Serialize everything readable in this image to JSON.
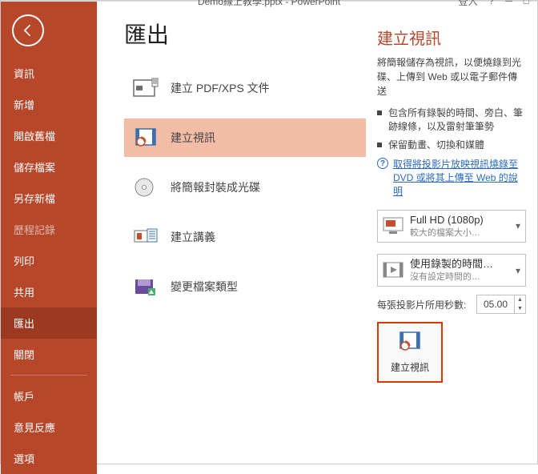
{
  "titlebar": {
    "filename": "Demo線上教學.pptx - PowerPoint",
    "signin": "登入",
    "help": "?",
    "minimize": "─",
    "restore": "□"
  },
  "sidebar": {
    "items": [
      "資訊",
      "新增",
      "開啟舊檔",
      "儲存檔案",
      "另存新檔",
      "歷程記錄",
      "列印",
      "共用",
      "匯出",
      "關閉"
    ],
    "bottom": [
      "帳戶",
      "意見反應",
      "選項"
    ]
  },
  "export": {
    "title": "匯出",
    "items": [
      {
        "label": "建立 PDF/XPS 文件"
      },
      {
        "label": "建立視訊"
      },
      {
        "label": "將簡報封裝成光碟"
      },
      {
        "label": "建立講義"
      },
      {
        "label": "變更檔案類型"
      }
    ]
  },
  "detail": {
    "title": "建立視訊",
    "desc": "將簡報儲存為視訊，以便燒錄到光碟、上傳到 Web 或以電子郵件傳送",
    "b1": "包含所有錄製的時間、旁白、筆跡線條，以及雷射筆筆勢",
    "b2": "保留動畫、切換和媒體",
    "helplink": "取得將投影片放映視訊燒錄至 DVD 或將其上傳至 Web 的說明",
    "quality_title": "Full HD (1080p)",
    "quality_sub": "較大的檔案大小…",
    "timing_title": "使用錄製的時間…",
    "timing_sub": "沒有設定時間的…",
    "sec_label": "每張投影片所用秒數:",
    "sec_value": "05.00",
    "create_btn": "建立視訊"
  }
}
